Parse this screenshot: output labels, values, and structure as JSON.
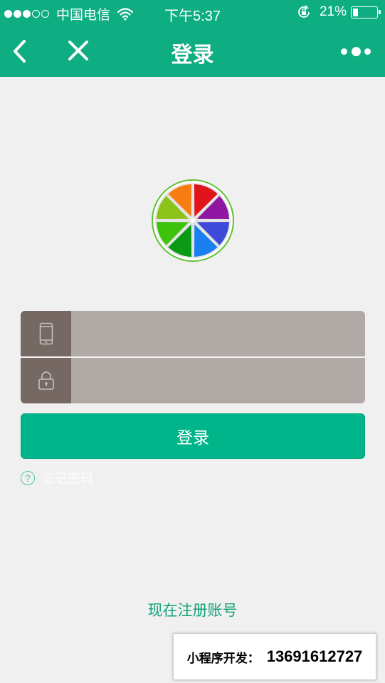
{
  "status_bar": {
    "carrier": "中国电信",
    "time": "下午5:37",
    "battery_percent": "21%",
    "battery_level": 0.21,
    "signal_bars_filled": 3,
    "signal_bars_total": 5
  },
  "nav": {
    "title": "登录",
    "back_icon": "chevron-left-icon",
    "close_icon": "close-icon",
    "more_icon": "more-dots-icon"
  },
  "form": {
    "phone": {
      "icon": "phone-icon",
      "placeholder": "",
      "value": ""
    },
    "password": {
      "icon": "lock-icon",
      "placeholder": "",
      "value": ""
    }
  },
  "login_button": {
    "label": "登录"
  },
  "forgot_password": {
    "icon": "question-icon",
    "label": "忘记密码"
  },
  "register_link": {
    "label": "现在注册账号"
  },
  "promo_banner": {
    "label": "小程序开发：",
    "phone": "13691612727"
  },
  "colors": {
    "brand": "#0fae82",
    "button": "#00b589",
    "input_bg": "#b1a9a6",
    "icon_bg": "#766862",
    "page_bg": "#f0f0f0"
  }
}
